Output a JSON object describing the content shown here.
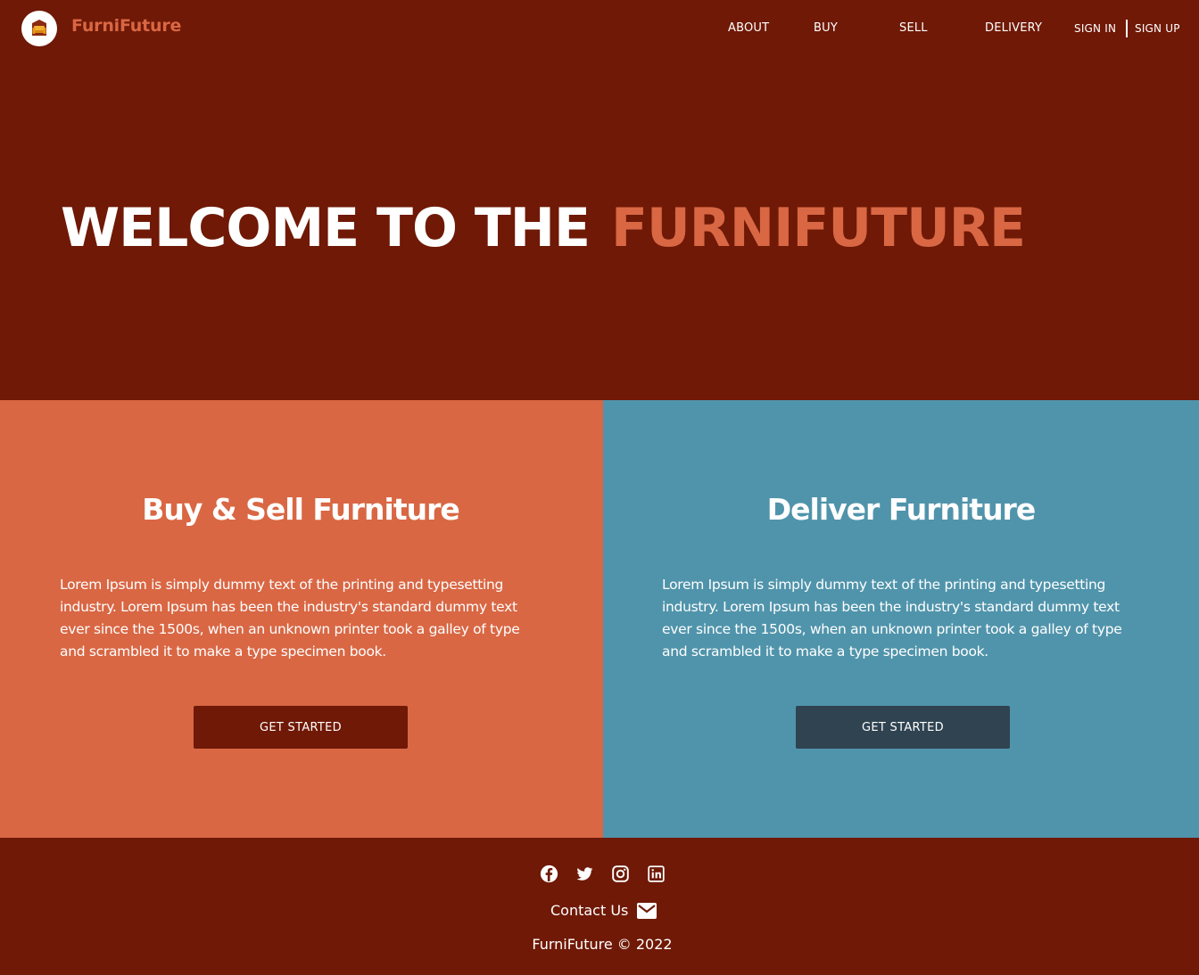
{
  "header": {
    "brand": "FurniFuture",
    "nav": {
      "about": "ABOUT",
      "buy": "BUY",
      "sell": "SELL",
      "delivery": "DELIVERY",
      "sign_in": "SIGN IN",
      "sign_up": "SIGN UP"
    }
  },
  "hero": {
    "title_plain": "WELCOME TO THE",
    "title_accent": "FURNIFUTURE"
  },
  "panels": [
    {
      "title": "Buy & Sell Furniture",
      "text": "Lorem Ipsum is simply dummy text of the printing and typesetting industry. Lorem Ipsum has been the industry's standard dummy text ever since the 1500s, when an unknown printer took a galley of type and scrambled it to make a type specimen book.",
      "button": "GET STARTED"
    },
    {
      "title": "Deliver Furniture",
      "text": "Lorem Ipsum is simply dummy text of the printing and typesetting industry. Lorem Ipsum has been the industry's standard dummy text ever since the 1500s, when an unknown printer took a galley of type and scrambled it to make a type specimen book.",
      "button": "GET STARTED"
    }
  ],
  "footer": {
    "social_icons": [
      "facebook-icon",
      "twitter-icon",
      "instagram-icon",
      "linkedin-icon"
    ],
    "contact_label": "Contact Us",
    "contact_icon": "mail-icon",
    "copyright": "FurniFuture © 2022"
  },
  "colors": {
    "background": "#6f1906",
    "accent": "#d96744",
    "panel_right": "#5094ab",
    "button_dark": "#2f4351"
  }
}
